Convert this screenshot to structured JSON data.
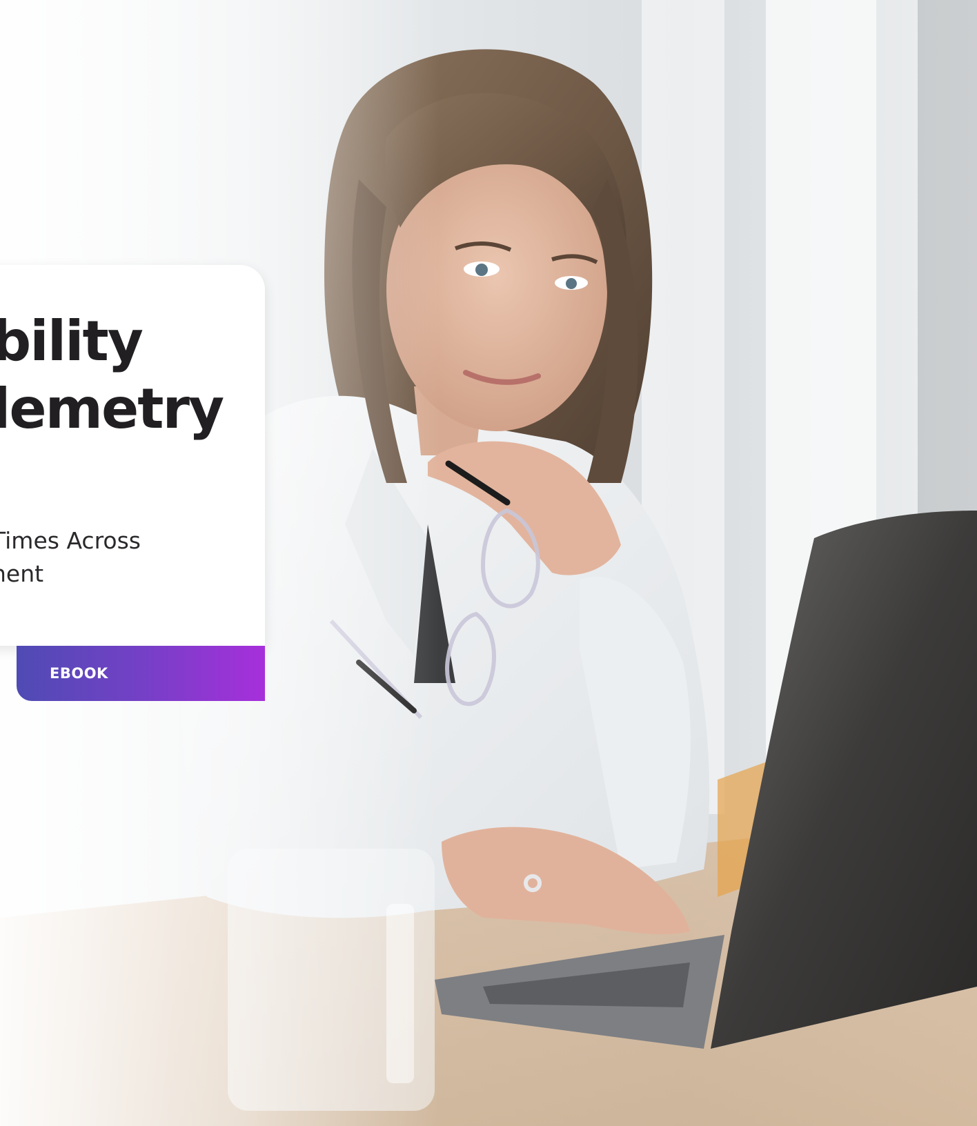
{
  "card": {
    "title_lines": [
      "bility",
      "lemetry"
    ],
    "subtitle_lines": [
      "Times Across",
      "nent"
    ]
  },
  "tag": {
    "label": "EBOOK",
    "gradient_colors": [
      "#4f4bb4",
      "#a72fdb"
    ]
  },
  "photo": {
    "subject": "woman-at-laptop-photo"
  }
}
